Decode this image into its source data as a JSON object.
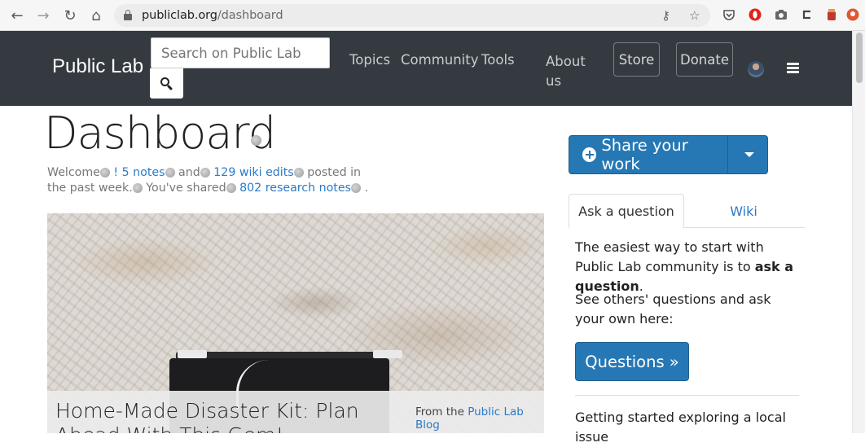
{
  "browser": {
    "url_domain": "publiclab.org",
    "url_path": "/dashboard",
    "back_icon": "←",
    "forward_icon": "→",
    "reload_icon": "↻",
    "home_icon": "⌂",
    "key_icon": "⚷",
    "star_icon": "☆"
  },
  "navbar": {
    "brand": "Public Lab",
    "search_placeholder": "Search on Public Lab",
    "links": {
      "topics": "Topics",
      "community": "Community",
      "tools": "Tools",
      "about": "About us"
    },
    "store": "Store",
    "donate": "Donate"
  },
  "main": {
    "title": "Dashboard",
    "welcome": {
      "prefix": "Welcome",
      "bang": "!",
      "notes_link": "5 notes",
      "and": "and",
      "wiki_link": "129 wiki edits",
      "posted": "posted in the past week.",
      "shared": "You've shared",
      "research_link": "802 research notes",
      "end": "."
    },
    "blog_card": {
      "title": "Home-Made Disaster Kit: Plan Ahead With This Gem!",
      "from_prefix": "From the",
      "from_link": "Public Lab Blog"
    }
  },
  "sidebar": {
    "share_button": "Share your work",
    "tabs": {
      "ask": "Ask a question",
      "wiki": "Wiki"
    },
    "intro_text": "The easiest way to start with Public Lab community is to",
    "intro_bold": "ask a question",
    "intro_end": ".",
    "see_others": "See others' questions and ask your own here:",
    "questions_button": "Questions »",
    "getting_started": "Getting started exploring a local issue"
  },
  "colors": {
    "navbar_bg": "#343a40",
    "primary": "#2678b5",
    "link": "#2a7ac8"
  }
}
